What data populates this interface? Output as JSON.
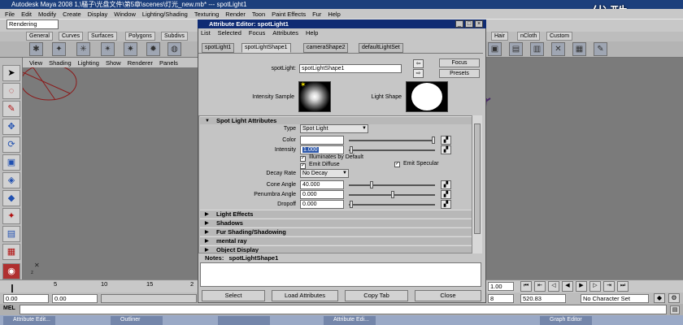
{
  "app": {
    "title": "Autodesk Maya 2008 1,\\騷子\\光盘文件\\第5章\\scenes\\灯光_new.mb* --- spotLight1",
    "watermark": "优酷",
    "menu": [
      "File",
      "Edit",
      "Modify",
      "Create",
      "Display",
      "Window",
      "Lighting/Shading",
      "Texturing",
      "Render",
      "Toon",
      "Paint Effects",
      "Fur",
      "Help"
    ],
    "mode": "Rendering",
    "shelf_tabs": [
      "General",
      "Curves",
      "Surfaces",
      "Polygons",
      "Subdivs",
      "Hair",
      "nCloth",
      "Custom"
    ],
    "panel_menu": [
      "View",
      "Shading",
      "Lighting",
      "Show",
      "Renderer",
      "Panels"
    ]
  },
  "timeline": {
    "ticks": [
      "5",
      "10",
      "15",
      "2"
    ],
    "current_time": "1.00",
    "range_start": "0.00",
    "range_start2": "0.00",
    "range_end": "8",
    "range_end_value": "520.83",
    "char_set": "No Character Set"
  },
  "cmdline": {
    "label": "MEL"
  },
  "taskbar": [
    "Attribute Edit...",
    "Outliner",
    "",
    "Attribute Edi...",
    "Graph Editor"
  ],
  "attribute_editor": {
    "title": "Attribute Editor: spotLight1",
    "menu": [
      "List",
      "Selected",
      "Focus",
      "Attributes",
      "Help"
    ],
    "tabs": [
      "spotLight1",
      "spotLightShape1",
      "cameraShape2",
      "defaultLightSet"
    ],
    "node_label": "spotLight:",
    "node_value": "spotLightShape1",
    "focus_label": "Focus",
    "presets_label": "Presets",
    "intensity_sample_label": "Intensity Sample",
    "light_shape_label": "Light Shape",
    "section_title": "Spot Light Attributes",
    "type_label": "Type",
    "type_value": "Spot Light",
    "color_label": "Color",
    "intensity_label": "Intensity",
    "intensity_value": "1.000",
    "illuminates_label": "Illuminates by Default",
    "emit_diffuse_label": "Emit Diffuse",
    "emit_specular_label": "Emit Specular",
    "decay_label": "Decay Rate",
    "decay_value": "No Decay",
    "cone_label": "Cone Angle",
    "cone_value": "40.000",
    "penumbra_label": "Penumbra Angle",
    "penumbra_value": "0.000",
    "dropoff_label": "Dropoff",
    "dropoff_value": "0.000",
    "collapsed_sections": [
      "Light Effects",
      "Shadows",
      "Fur Shading/Shadowing",
      "mental ray",
      "Object Display"
    ],
    "notes_label": "Notes:",
    "notes_node": "spotLightShape1",
    "buttons": [
      "Select",
      "Load Attributes",
      "Copy Tab",
      "Close"
    ]
  }
}
